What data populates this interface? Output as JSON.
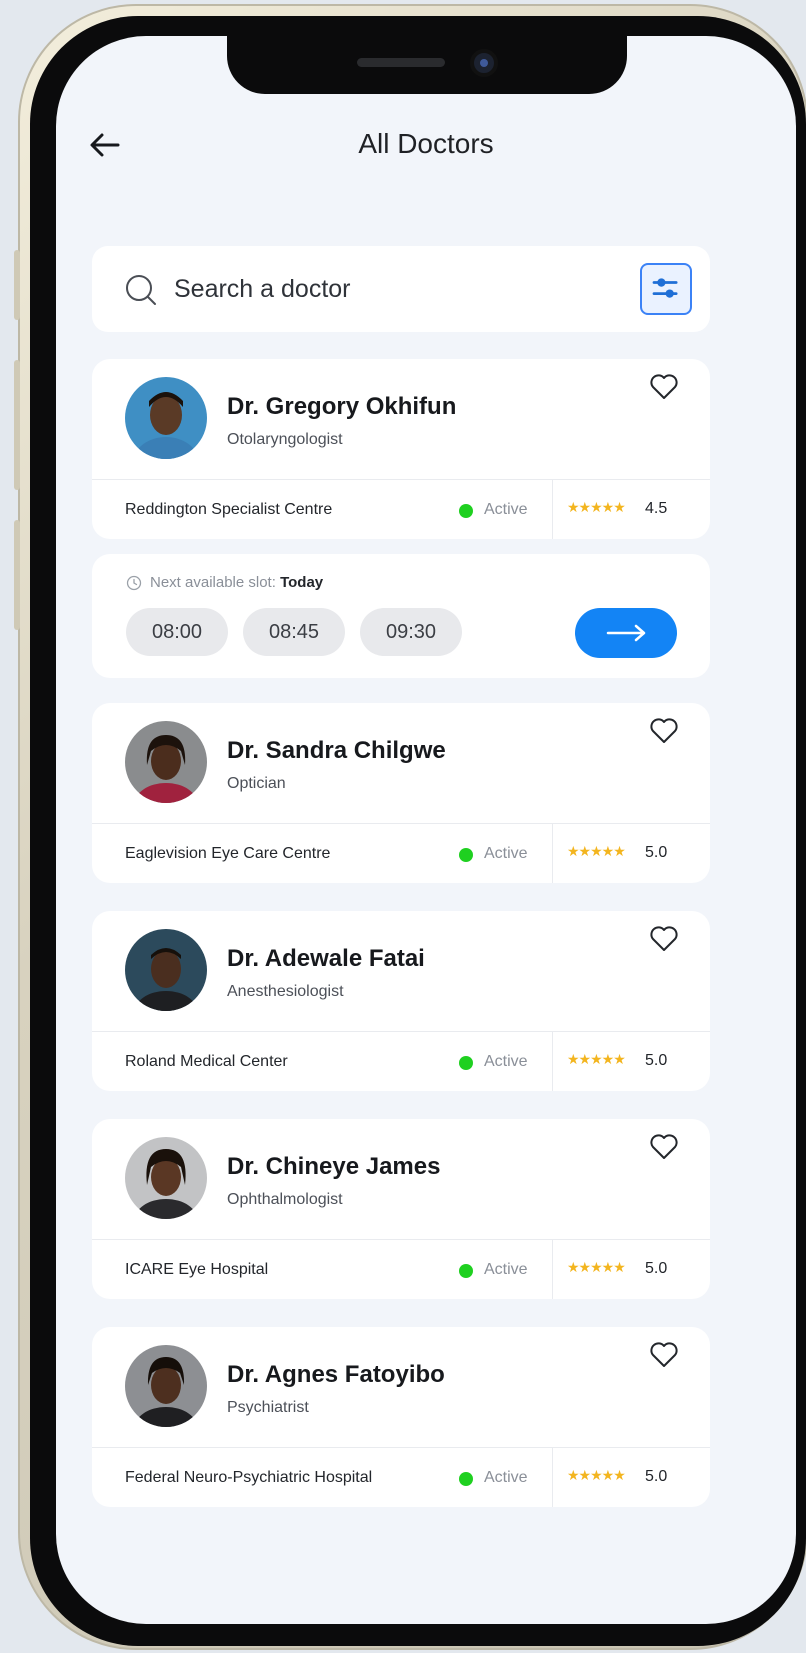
{
  "header": {
    "title": "All Doctors"
  },
  "search": {
    "placeholder": "Search a doctor"
  },
  "doctors": [
    {
      "name": "Dr. Gregory Okhifun",
      "specialty": "Otolaryngologist",
      "hospital": "Reddington Specialist Centre",
      "status": "Active",
      "stars": "★★★★★",
      "rating": "4.5"
    },
    {
      "name": "Dr. Sandra Chilgwe",
      "specialty": "Optician",
      "hospital": "Eaglevision Eye Care Centre",
      "status": "Active",
      "stars": "★★★★★",
      "rating": "5.0"
    },
    {
      "name": "Dr. Adewale Fatai",
      "specialty": "Anesthesiologist",
      "hospital": "Roland Medical Center",
      "status": "Active",
      "stars": "★★★★★",
      "rating": "5.0"
    },
    {
      "name": "Dr. Chineye James",
      "specialty": "Ophthalmologist",
      "hospital": "ICARE Eye Hospital",
      "status": "Active",
      "stars": "★★★★★",
      "rating": "5.0"
    },
    {
      "name": "Dr. Agnes Fatoyibo",
      "specialty": "Psychiatrist",
      "hospital": "Federal Neuro-Psychiatric Hospital",
      "status": "Active",
      "stars": "★★★★★",
      "rating": "5.0"
    }
  ],
  "slots": {
    "label": "Next available slot: ",
    "day": "Today",
    "times": [
      "08:00",
      "08:45",
      "09:30"
    ]
  },
  "colors": {
    "accent": "#1384f5",
    "status_active": "#1fd020",
    "star": "#f3b51f",
    "background": "#f2f5fa"
  },
  "icons": {
    "back": "arrow-left-icon",
    "search": "search-icon",
    "filter": "sliders-icon",
    "favorite": "heart-icon",
    "clock": "clock-icon",
    "next": "arrow-right-icon"
  }
}
